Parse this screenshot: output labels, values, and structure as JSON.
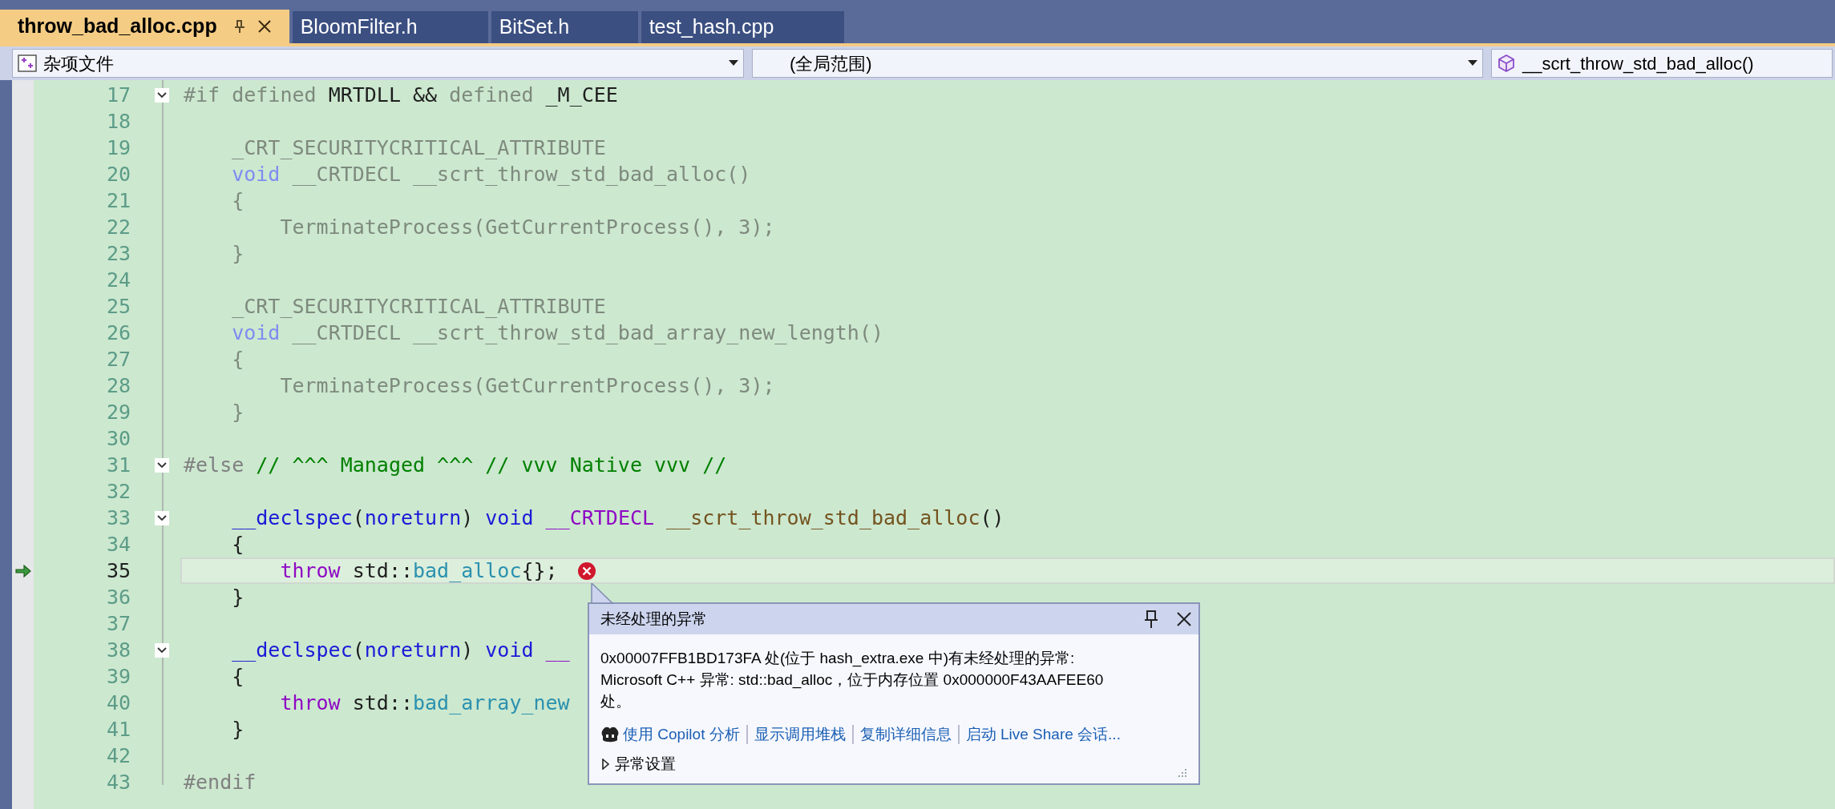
{
  "tabs": [
    {
      "label": "throw_bad_alloc.cpp",
      "selected": true,
      "pinned": true,
      "closable": true
    },
    {
      "label": "BloomFilter.h",
      "selected": false
    },
    {
      "label": "BitSet.h",
      "selected": false
    },
    {
      "label": "test_hash.cpp",
      "selected": false
    }
  ],
  "nav": [
    {
      "kind": "project",
      "text": "杂项文件"
    },
    {
      "kind": "scope",
      "text": "(全局范围)"
    },
    {
      "kind": "member",
      "text": "__scrt_throw_std_bad_alloc()"
    }
  ],
  "code_lines": [
    {
      "num": "17",
      "collapsible": true,
      "tokens": [
        {
          "kind": "inactive",
          "text": "#if defined "
        },
        {
          "kind": "plain",
          "text": "MRTDLL && "
        },
        {
          "kind": "inactive",
          "text": "defined "
        },
        {
          "kind": "plain",
          "text": "_M_CEE"
        }
      ]
    },
    {
      "num": "18"
    },
    {
      "num": "19",
      "tokens": [
        {
          "kind": "inactive",
          "text": "    _CRT_SECURITYCRITICAL_ATTRIBUTE"
        }
      ]
    },
    {
      "num": "20",
      "tokens": [
        {
          "kind": "inactive_keyword",
          "text": "    void"
        },
        {
          "kind": "inactive",
          "text": " __CRTDECL __scrt_throw_std_bad_alloc()"
        }
      ]
    },
    {
      "num": "21",
      "tokens": [
        {
          "kind": "inactive",
          "text": "    {"
        }
      ]
    },
    {
      "num": "22",
      "tokens": [
        {
          "kind": "inactive",
          "text": "        TerminateProcess(GetCurrentProcess(), 3);"
        }
      ]
    },
    {
      "num": "23",
      "tokens": [
        {
          "kind": "inactive",
          "text": "    }"
        }
      ]
    },
    {
      "num": "24"
    },
    {
      "num": "25",
      "tokens": [
        {
          "kind": "inactive",
          "text": "    _CRT_SECURITYCRITICAL_ATTRIBUTE"
        }
      ]
    },
    {
      "num": "26",
      "tokens": [
        {
          "kind": "inactive_keyword",
          "text": "    void"
        },
        {
          "kind": "inactive",
          "text": " __CRTDECL __scrt_throw_std_bad_array_new_length()"
        }
      ]
    },
    {
      "num": "27",
      "tokens": [
        {
          "kind": "inactive",
          "text": "    {"
        }
      ]
    },
    {
      "num": "28",
      "tokens": [
        {
          "kind": "inactive",
          "text": "        TerminateProcess(GetCurrentProcess(), 3);"
        }
      ]
    },
    {
      "num": "29",
      "tokens": [
        {
          "kind": "inactive",
          "text": "    }"
        }
      ]
    },
    {
      "num": "30"
    },
    {
      "num": "31",
      "collapsible": true,
      "tokens": [
        {
          "kind": "preproc",
          "text": "#else"
        },
        {
          "kind": "comment",
          "text": " // ^^^ Managed ^^^ // vvv Native vvv //"
        }
      ]
    },
    {
      "num": "32"
    },
    {
      "num": "33",
      "collapsible": true,
      "tokens": [
        {
          "kind": "keyword",
          "text": "    __declspec"
        },
        {
          "kind": "plain",
          "text": "("
        },
        {
          "kind": "keyword",
          "text": "noreturn"
        },
        {
          "kind": "plain",
          "text": ") "
        },
        {
          "kind": "keyword",
          "text": "void"
        },
        {
          "kind": "macro",
          "text": " __CRTDECL"
        },
        {
          "kind": "function",
          "text": " __scrt_throw_std_bad_alloc"
        },
        {
          "kind": "plain",
          "text": "()"
        }
      ]
    },
    {
      "num": "34",
      "tokens": [
        {
          "kind": "plain",
          "text": "    {"
        }
      ]
    },
    {
      "num": "35",
      "current": true,
      "error": true,
      "tokens": [
        {
          "kind": "control",
          "text": "        throw"
        },
        {
          "kind": "plain",
          "text": " std::"
        },
        {
          "kind": "type",
          "text": "bad_alloc"
        },
        {
          "kind": "plain",
          "text": "{};"
        }
      ]
    },
    {
      "num": "36",
      "tokens": [
        {
          "kind": "plain",
          "text": "    }"
        }
      ]
    },
    {
      "num": "37"
    },
    {
      "num": "38",
      "collapsible": true,
      "tokens": [
        {
          "kind": "keyword",
          "text": "    __declspec"
        },
        {
          "kind": "plain",
          "text": "("
        },
        {
          "kind": "keyword",
          "text": "noreturn"
        },
        {
          "kind": "plain",
          "text": ") "
        },
        {
          "kind": "keyword",
          "text": "void"
        },
        {
          "kind": "macro",
          "text": " __"
        }
      ]
    },
    {
      "num": "39",
      "tokens": [
        {
          "kind": "plain",
          "text": "    {"
        }
      ]
    },
    {
      "num": "40",
      "tokens": [
        {
          "kind": "control",
          "text": "        throw"
        },
        {
          "kind": "plain",
          "text": " std::"
        },
        {
          "kind": "type",
          "text": "bad_array_new"
        }
      ]
    },
    {
      "num": "41",
      "tokens": [
        {
          "kind": "plain",
          "text": "    }"
        }
      ]
    },
    {
      "num": "42"
    },
    {
      "num": "43",
      "tokens": [
        {
          "kind": "preproc",
          "text": "#endif"
        }
      ]
    }
  ],
  "exception_popup": {
    "title": "未经处理的异常",
    "message": "0x00007FFB1BD173FA 处(位于 hash_extra.exe 中)有未经处理的异常: Microsoft C++ 异常: std::bad_alloc，位于内存位置 0x000000F43AAFEE60 处。",
    "links": [
      {
        "kind": "copilot",
        "text": "使用 Copilot 分析"
      },
      {
        "kind": "plain",
        "text": "显示调用堆栈"
      },
      {
        "kind": "plain",
        "text": "复制详细信息"
      },
      {
        "kind": "plain",
        "text": "启动 Live Share 会话..."
      }
    ],
    "settings": {
      "text": "异常设置",
      "expanded": false
    }
  }
}
